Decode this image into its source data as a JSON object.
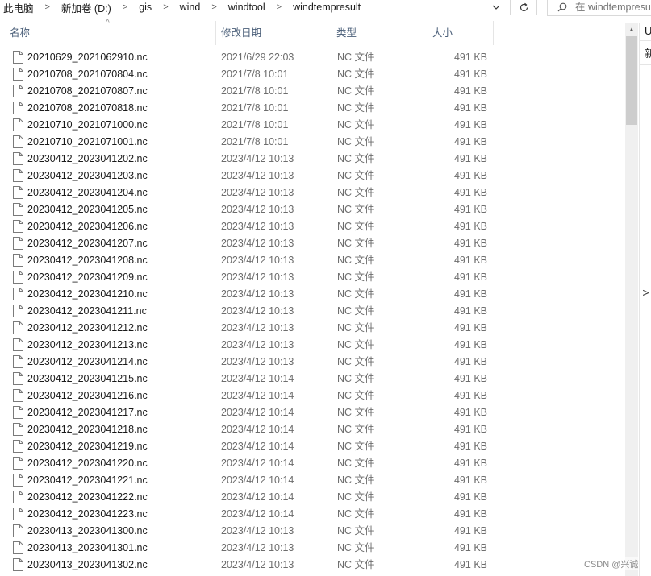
{
  "address": {
    "crumbs": [
      "此电脑",
      "新加卷 (D:)",
      "gis",
      "wind",
      "windtool",
      "windtempresult"
    ],
    "search_placeholder": "在 windtempresult 中搜索"
  },
  "columns": {
    "name": "名称",
    "date": "修改日期",
    "type": "类型",
    "size": "大小"
  },
  "files": [
    {
      "name": "20210629_2021062910.nc",
      "date": "2021/6/29 22:03",
      "type": "NC 文件",
      "size": "491 KB"
    },
    {
      "name": "20210708_2021070804.nc",
      "date": "2021/7/8 10:01",
      "type": "NC 文件",
      "size": "491 KB"
    },
    {
      "name": "20210708_2021070807.nc",
      "date": "2021/7/8 10:01",
      "type": "NC 文件",
      "size": "491 KB"
    },
    {
      "name": "20210708_2021070818.nc",
      "date": "2021/7/8 10:01",
      "type": "NC 文件",
      "size": "491 KB"
    },
    {
      "name": "20210710_2021071000.nc",
      "date": "2021/7/8 10:01",
      "type": "NC 文件",
      "size": "491 KB"
    },
    {
      "name": "20210710_2021071001.nc",
      "date": "2021/7/8 10:01",
      "type": "NC 文件",
      "size": "491 KB"
    },
    {
      "name": "20230412_2023041202.nc",
      "date": "2023/4/12 10:13",
      "type": "NC 文件",
      "size": "491 KB"
    },
    {
      "name": "20230412_2023041203.nc",
      "date": "2023/4/12 10:13",
      "type": "NC 文件",
      "size": "491 KB"
    },
    {
      "name": "20230412_2023041204.nc",
      "date": "2023/4/12 10:13",
      "type": "NC 文件",
      "size": "491 KB"
    },
    {
      "name": "20230412_2023041205.nc",
      "date": "2023/4/12 10:13",
      "type": "NC 文件",
      "size": "491 KB"
    },
    {
      "name": "20230412_2023041206.nc",
      "date": "2023/4/12 10:13",
      "type": "NC 文件",
      "size": "491 KB"
    },
    {
      "name": "20230412_2023041207.nc",
      "date": "2023/4/12 10:13",
      "type": "NC 文件",
      "size": "491 KB"
    },
    {
      "name": "20230412_2023041208.nc",
      "date": "2023/4/12 10:13",
      "type": "NC 文件",
      "size": "491 KB"
    },
    {
      "name": "20230412_2023041209.nc",
      "date": "2023/4/12 10:13",
      "type": "NC 文件",
      "size": "491 KB"
    },
    {
      "name": "20230412_2023041210.nc",
      "date": "2023/4/12 10:13",
      "type": "NC 文件",
      "size": "491 KB"
    },
    {
      "name": "20230412_2023041211.nc",
      "date": "2023/4/12 10:13",
      "type": "NC 文件",
      "size": "491 KB"
    },
    {
      "name": "20230412_2023041212.nc",
      "date": "2023/4/12 10:13",
      "type": "NC 文件",
      "size": "491 KB"
    },
    {
      "name": "20230412_2023041213.nc",
      "date": "2023/4/12 10:13",
      "type": "NC 文件",
      "size": "491 KB"
    },
    {
      "name": "20230412_2023041214.nc",
      "date": "2023/4/12 10:13",
      "type": "NC 文件",
      "size": "491 KB"
    },
    {
      "name": "20230412_2023041215.nc",
      "date": "2023/4/12 10:14",
      "type": "NC 文件",
      "size": "491 KB"
    },
    {
      "name": "20230412_2023041216.nc",
      "date": "2023/4/12 10:14",
      "type": "NC 文件",
      "size": "491 KB"
    },
    {
      "name": "20230412_2023041217.nc",
      "date": "2023/4/12 10:14",
      "type": "NC 文件",
      "size": "491 KB"
    },
    {
      "name": "20230412_2023041218.nc",
      "date": "2023/4/12 10:14",
      "type": "NC 文件",
      "size": "491 KB"
    },
    {
      "name": "20230412_2023041219.nc",
      "date": "2023/4/12 10:14",
      "type": "NC 文件",
      "size": "491 KB"
    },
    {
      "name": "20230412_2023041220.nc",
      "date": "2023/4/12 10:14",
      "type": "NC 文件",
      "size": "491 KB"
    },
    {
      "name": "20230412_2023041221.nc",
      "date": "2023/4/12 10:14",
      "type": "NC 文件",
      "size": "491 KB"
    },
    {
      "name": "20230412_2023041222.nc",
      "date": "2023/4/12 10:14",
      "type": "NC 文件",
      "size": "491 KB"
    },
    {
      "name": "20230412_2023041223.nc",
      "date": "2023/4/12 10:14",
      "type": "NC 文件",
      "size": "491 KB"
    },
    {
      "name": "20230413_2023041300.nc",
      "date": "2023/4/12 10:13",
      "type": "NC 文件",
      "size": "491 KB"
    },
    {
      "name": "20230413_2023041301.nc",
      "date": "2023/4/12 10:13",
      "type": "NC 文件",
      "size": "491 KB"
    },
    {
      "name": "20230413_2023041302.nc",
      "date": "2023/4/12 10:13",
      "type": "NC 文件",
      "size": "491 KB"
    }
  ],
  "right_pane": {
    "item1": "U",
    "item2": "新"
  },
  "watermark": "CSDN @兴诚"
}
